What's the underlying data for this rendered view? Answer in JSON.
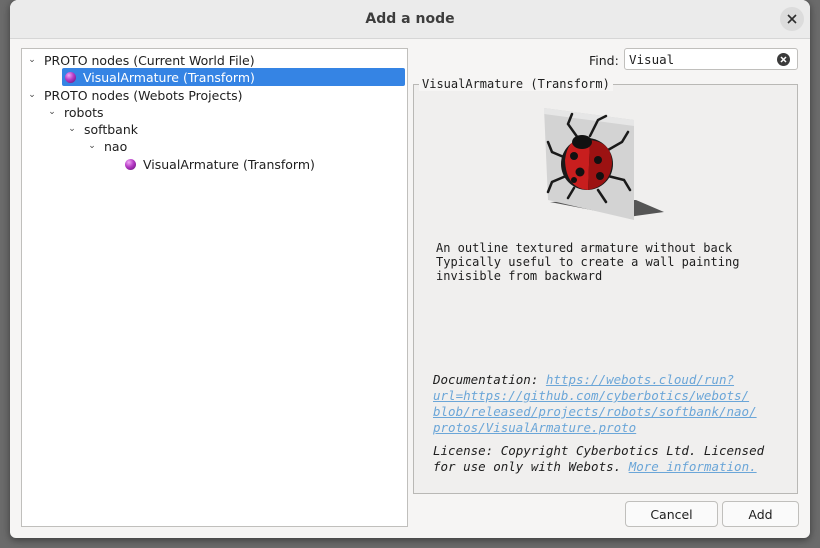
{
  "dialog": {
    "title": "Add a node"
  },
  "tree": {
    "items": [
      {
        "label": "PROTO nodes (Current World File)",
        "expanded": true
      },
      {
        "label": "VisualArmature (Transform)",
        "selected": true,
        "icon": "proto-node-icon"
      },
      {
        "label": "PROTO nodes (Webots Projects)",
        "expanded": true
      },
      {
        "label": "robots",
        "expanded": true
      },
      {
        "label": "softbank",
        "expanded": true
      },
      {
        "label": "nao",
        "expanded": true
      },
      {
        "label": "VisualArmature (Transform)",
        "icon": "proto-node-icon"
      }
    ]
  },
  "find": {
    "label": "Find:",
    "value": "Visual"
  },
  "preview": {
    "title": "VisualArmature (Transform)",
    "description": "An outline textured armature without back\nTypically useful to create a wall painting\ninvisible from backward",
    "doc_label": "Documentation:",
    "doc_link": "https://webots.cloud/run?url=https://github.com/cyberbotics/webots/blob/released/projects/robots/softbank/nao/protos/VisualArmature.proto",
    "doc_link_lines": [
      "https://webots.cloud/run?",
      "url=https://github.com/cyberbotics/webots/",
      "blob/released/projects/robots/softbank/nao/",
      "protos/VisualArmature.proto"
    ],
    "license_text": "License: Copyright Cyberbotics Ltd. Licensed for use only with Webots.",
    "license_link": "More information."
  },
  "buttons": {
    "cancel": "Cancel",
    "add": "Add"
  },
  "colors": {
    "selection": "#3584e4",
    "link": "#6ba6d8"
  }
}
